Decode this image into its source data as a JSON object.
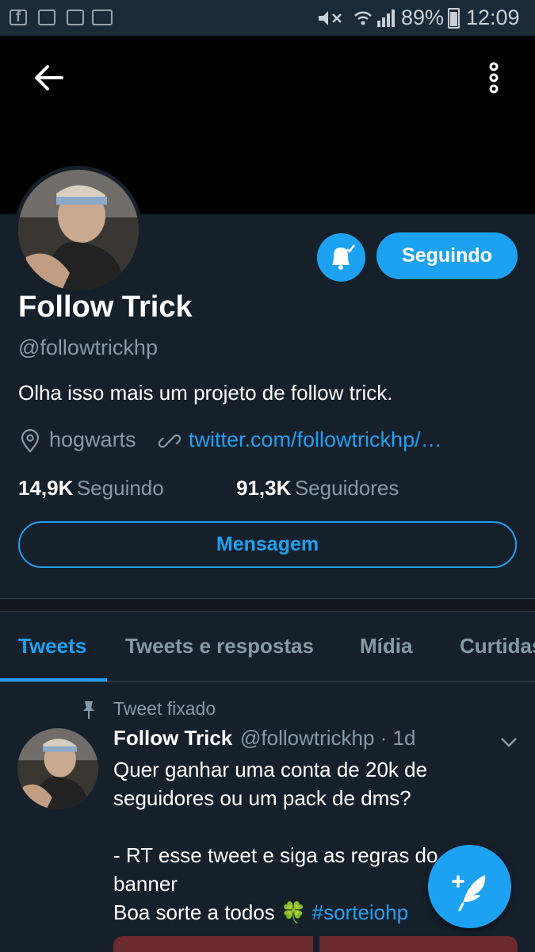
{
  "status_bar": {
    "battery": "89%",
    "time": "12:09",
    "icons": [
      "facebook-icon",
      "gallery-icon",
      "recycle-icon",
      "voicemail-icon",
      "mute-icon",
      "wifi-icon",
      "signal-icon",
      "battery-icon"
    ]
  },
  "profile": {
    "name": "Follow Trick",
    "handle": "@followtrickhp",
    "bio": "Olha isso mais um projeto de follow trick.",
    "location": "hogwarts",
    "link": "twitter.com/followtrickhp/…",
    "following_count": "14,9K",
    "following_label": "Seguindo",
    "followers_count": "91,3K",
    "followers_label": "Seguidores",
    "follow_button": "Seguindo",
    "message_button": "Mensagem"
  },
  "tabs": [
    "Tweets",
    "Tweets e respostas",
    "Mídia",
    "Curtidas"
  ],
  "active_tab": "Tweets",
  "tweet": {
    "pinned_label": "Tweet fixado",
    "name": "Follow Trick",
    "meta": "@followtrickhp · 1d",
    "line1": "Quer ganhar uma conta de 20k de seguidores ou um pack de dms?",
    "line2": "- RT esse tweet e siga as regras do banner",
    "line3": "Boa sorte a todos 🍀",
    "hashtag": "#sorteiohp"
  },
  "colors": {
    "accent": "#1da1f2",
    "background": "#15202b",
    "secondary_text": "#8899a6"
  }
}
